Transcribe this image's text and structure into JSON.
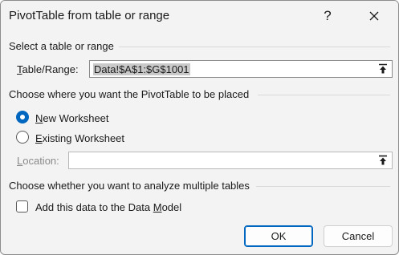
{
  "dialog": {
    "title": "PivotTable from table or range",
    "help_glyph": "?"
  },
  "source": {
    "section_title": "Select a table or range",
    "label_accel": "T",
    "label_rest": "able/Range:",
    "value": "Data!$A$1:$G$1001"
  },
  "placement": {
    "section_title": "Choose where you want the PivotTable to be placed",
    "options": [
      {
        "accel": "N",
        "rest": "ew Worksheet",
        "checked": true
      },
      {
        "accel": "E",
        "rest": "xisting Worksheet",
        "checked": false
      }
    ],
    "location_label_accel": "L",
    "location_label_rest": "ocation:",
    "location_value": ""
  },
  "multiple_tables": {
    "section_title": "Choose whether you want to analyze multiple tables",
    "checkbox_prefix": "Add this data to the Data ",
    "checkbox_accel": "M",
    "checkbox_suffix": "odel",
    "checked": false
  },
  "buttons": {
    "ok_label": "OK",
    "cancel_label": "Cancel"
  },
  "colors": {
    "accent": "#0067c0",
    "dialog_bg": "#f3f3f3"
  },
  "icons": [
    "help-icon",
    "close-icon",
    "collapse-dialog-icon",
    "radio-icon",
    "checkbox-icon"
  ]
}
